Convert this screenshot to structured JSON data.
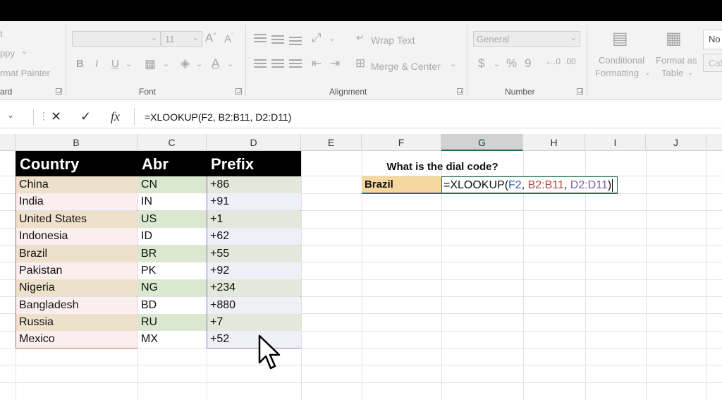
{
  "ribbon": {
    "clipboard": {
      "cut": "t",
      "copy": "ppy",
      "format_painter": "rmat Painter",
      "group_label": "ard"
    },
    "font": {
      "size": "11",
      "group_label": "Font"
    },
    "alignment": {
      "wrap_text": "Wrap Text",
      "merge_center": "Merge & Center",
      "group_label": "Alignment"
    },
    "number": {
      "format": "General",
      "currency": "$",
      "percent": "%",
      "comma": "9",
      "group_label": "Number"
    },
    "styles": {
      "conditional_1": "Conditional",
      "conditional_2": "Formatting",
      "format_as_1": "Format as",
      "format_as_2": "Table",
      "normal": "No",
      "calc": "Cal"
    }
  },
  "formula_bar": {
    "formula": "=XLOOKUP(F2, B2:B11, D2:D11)"
  },
  "columns": [
    "B",
    "C",
    "D",
    "E",
    "F",
    "G",
    "H",
    "I",
    "J"
  ],
  "table": {
    "headers": [
      "Country",
      "Abr",
      "Prefix"
    ],
    "rows": [
      [
        "China",
        "CN",
        "+86"
      ],
      [
        "India",
        "IN",
        "+91"
      ],
      [
        "United States",
        "US",
        "+1"
      ],
      [
        "Indonesia",
        "ID",
        "+62"
      ],
      [
        "Brazil",
        "BR",
        "+55"
      ],
      [
        "Pakistan",
        "PK",
        "+92"
      ],
      [
        "Nigeria",
        "NG",
        "+234"
      ],
      [
        "Bangladesh",
        "BD",
        "+880"
      ],
      [
        "Russia",
        "RU",
        "+7"
      ],
      [
        "Mexico",
        "MX",
        "+52"
      ]
    ]
  },
  "lookup": {
    "question": "What is the dial code?",
    "input": "Brazil",
    "formula_prefix": "=XLOOKUP(",
    "arg1": "F2",
    "comma1": ", ",
    "arg2": "B2:B11",
    "comma2": ", ",
    "arg3": "D2:D11",
    "close": ")"
  },
  "colors": {
    "accent": "#217346",
    "ref_f2": "#2f5fa7",
    "ref_b": "#b0483f",
    "ref_d": "#7a5ea8"
  }
}
